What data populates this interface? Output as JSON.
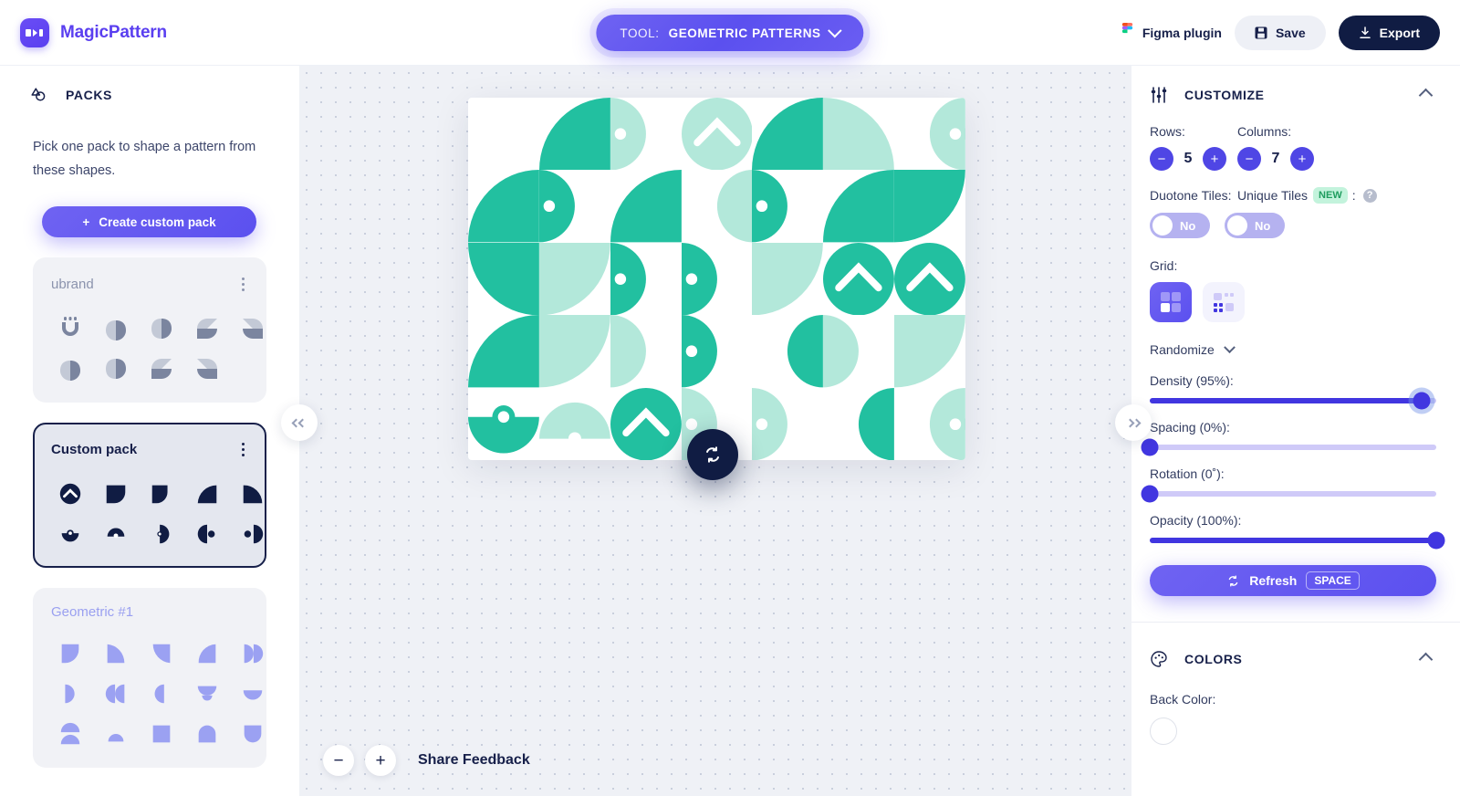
{
  "app": {
    "brand": "MagicPattern",
    "logo_icon": "magicpattern-logo-icon"
  },
  "topbar": {
    "tool_prefix": "TOOL:",
    "tool_value": "GEOMETRIC PATTERNS",
    "tool_caret_icon": "chevron-down-icon",
    "figma_label": "Figma plugin",
    "figma_icon": "figma-icon",
    "save_label": "Save",
    "save_icon": "save-disk-icon",
    "export_label": "Export",
    "export_icon": "download-icon"
  },
  "sidebar": {
    "section_title": "PACKS",
    "section_icon": "packs-icon",
    "description": "Pick one pack to shape a pattern from these shapes.",
    "create_button": "Create custom pack",
    "create_icon": "plus-icon",
    "packs": [
      {
        "name": "ubrand",
        "selected": false,
        "menu_icon": "kebab-menu-icon"
      },
      {
        "name": "Custom pack",
        "selected": true,
        "menu_icon": "kebab-menu-icon"
      },
      {
        "name": "Geometric #1",
        "selected": false,
        "menu_icon": "kebab-menu-icon"
      }
    ]
  },
  "canvas": {
    "collapse_left_icon": "chevron-double-left-icon",
    "collapse_right_icon": "chevron-double-right-icon",
    "refresh_fab_icon": "refresh-icon",
    "zoom_out_label": "−",
    "zoom_in_label": "+",
    "feedback_label": "Share Feedback",
    "back_color": "#ffffff",
    "pattern_colors": {
      "dark_teal": "#22c0a0",
      "light_teal": "#b3e8da",
      "background": "#ffffff"
    }
  },
  "customize": {
    "title": "CUSTOMIZE",
    "icon": "sliders-icon",
    "collapse_icon": "chevron-up-icon",
    "rows_label": "Rows:",
    "rows_value": "5",
    "columns_label": "Columns:",
    "columns_value": "7",
    "minus_label": "−",
    "plus_label": "+",
    "duotone_label": "Duotone Tiles:",
    "duotone_value": "No",
    "unique_label": "Unique Tiles",
    "unique_badge": "NEW",
    "unique_colon": ":",
    "unique_value": "No",
    "help_label": "?",
    "grid_label": "Grid:",
    "grid_option_selected": "grid-uniform",
    "grid_option_alt": "grid-mixed",
    "randomize_label": "Randomize",
    "randomize_caret_icon": "chevron-down-icon",
    "sliders": [
      {
        "label": "Density (95%):",
        "value": 95,
        "name": "density"
      },
      {
        "label": "Spacing (0%):",
        "value": 0,
        "name": "spacing"
      },
      {
        "label": "Rotation (0˚):",
        "value": 0,
        "name": "rotation"
      },
      {
        "label": "Opacity (100%):",
        "value": 100,
        "name": "opacity"
      }
    ],
    "refresh_label": "Refresh",
    "refresh_icon": "refresh-icon",
    "refresh_shortcut": "SPACE"
  },
  "colors": {
    "title": "COLORS",
    "icon": "palette-icon",
    "collapse_icon": "chevron-up-icon",
    "back_color_label": "Back Color:",
    "back_color_value": "#ffffff"
  }
}
